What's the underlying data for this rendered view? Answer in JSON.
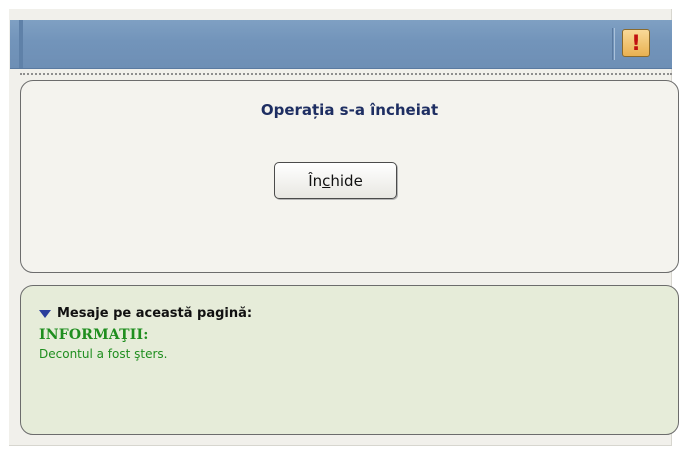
{
  "colors": {
    "titlebar": "#7294ba",
    "title_text": "#1e2e62",
    "info_green": "#1f8e1f",
    "alert_mark": "#c11010",
    "alert_bg": "#e9b151",
    "messages_bg": "#e6ecd9"
  },
  "titlebar": {
    "alert_icon": "exclamation-icon",
    "alert_glyph": "!"
  },
  "dialog": {
    "title": "Operația s-a încheiat",
    "close_button": {
      "before": "În",
      "underlined": "c",
      "after": "hide"
    }
  },
  "messages": {
    "toggle_icon": "triangle-down-icon",
    "header": "Mesaje pe această pagină:",
    "type_label": "INFORMAŢII:",
    "text": "Decontul a fost şters."
  }
}
